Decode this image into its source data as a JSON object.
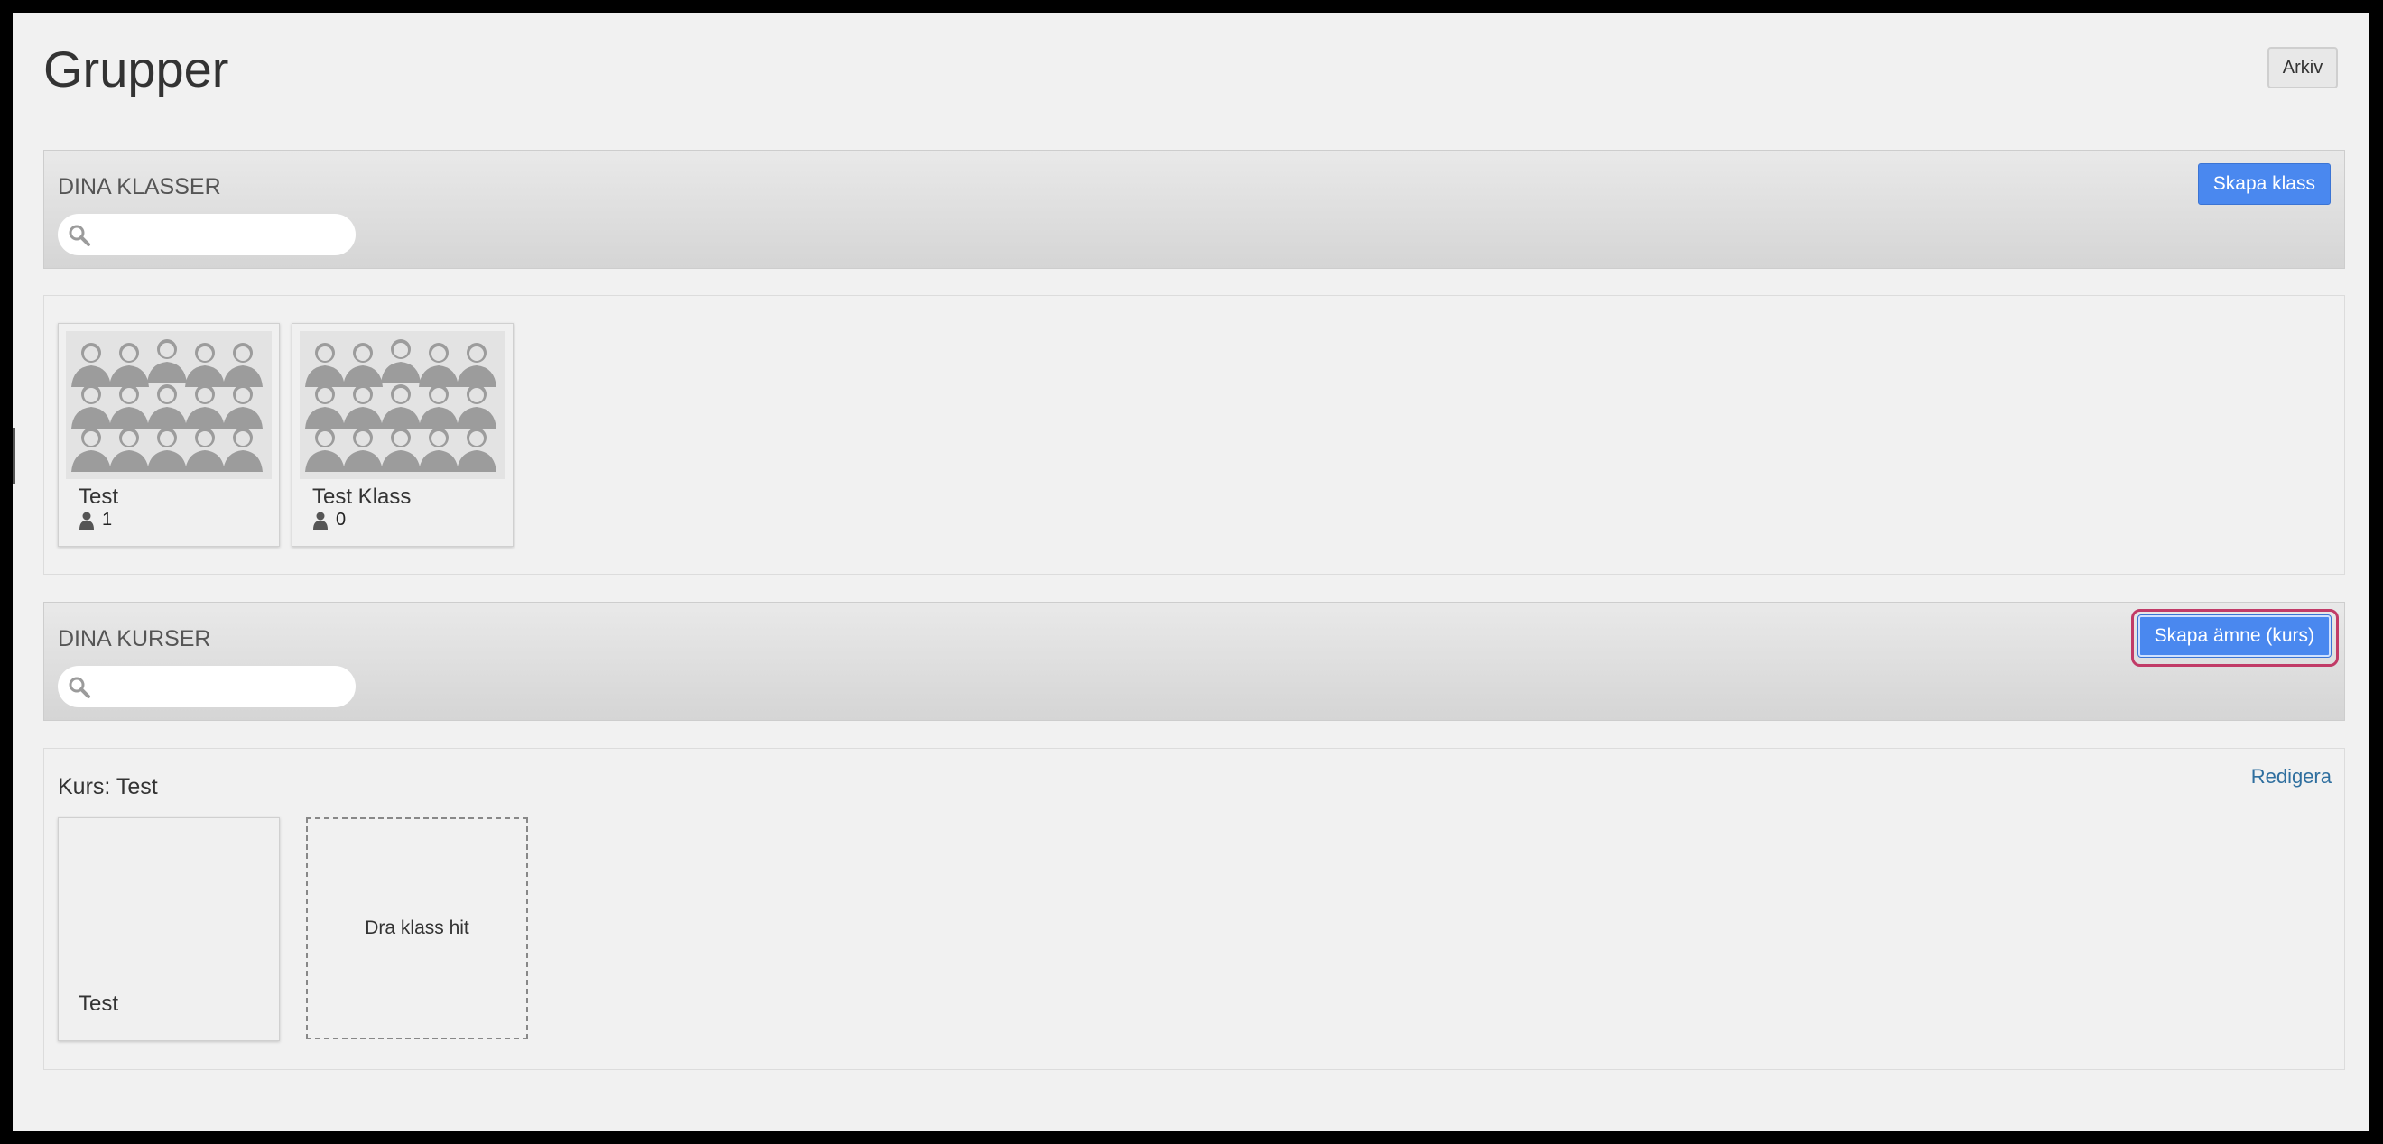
{
  "page": {
    "title": "Grupper",
    "archive_label": "Arkiv"
  },
  "classes_section": {
    "title": "DINA KLASSER",
    "create_label": "Skapa klass",
    "search_placeholder": ""
  },
  "classes": [
    {
      "name": "Test",
      "member_count": "1"
    },
    {
      "name": "Test Klass",
      "member_count": "0"
    }
  ],
  "courses_section": {
    "title": "DINA KURSER",
    "create_label": "Skapa ämne (kurs)",
    "search_placeholder": ""
  },
  "course": {
    "title": "Kurs: Test",
    "edit_label": "Redigera",
    "class_name": "Test",
    "drop_label": "Dra klass hit"
  },
  "icons": {
    "search": "search-icon",
    "member": "person-icon",
    "class_image": "students-group-image"
  },
  "colors": {
    "primary": "#4a88ef",
    "focus_ring": "#c13b67",
    "link": "#2f6f9f"
  }
}
